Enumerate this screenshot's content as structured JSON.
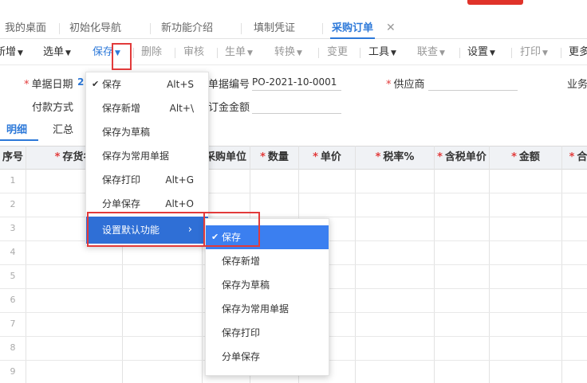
{
  "colors": {
    "accent": "#2d79d9",
    "highlight": "#3b7ff0",
    "annotation_red": "#e23a3a"
  },
  "tabs": [
    {
      "label": "我的桌面"
    },
    {
      "label": "初始化导航"
    },
    {
      "label": "新功能介绍"
    },
    {
      "label": "填制凭证"
    },
    {
      "label": "采购订单"
    }
  ],
  "tab_close": "✕",
  "toolbar": {
    "new": "新增",
    "select": "选单",
    "save": "保存",
    "delete": "删除",
    "audit": "审核",
    "generate": "生单",
    "convert": "转换",
    "change": "变更",
    "tools": "工具",
    "linked": "联查",
    "settings": "设置",
    "print": "打印",
    "more": "更多"
  },
  "form": {
    "date_label": "单据日期",
    "date_value": "2",
    "number_label": "单据编号",
    "number_value": "PO-2021-10-0001",
    "supplier_label": "供应商",
    "business_label": "业务",
    "payment_label": "付款方式",
    "deposit_label": "订金金额"
  },
  "subtabs": {
    "detail": "明细",
    "summary": "汇总"
  },
  "grid": {
    "columns": [
      "序号",
      "存货名",
      "",
      "采购单位",
      "数量",
      "单价",
      "税率%",
      "含税单价",
      "金额",
      "合"
    ],
    "required": [
      false,
      true,
      false,
      false,
      true,
      true,
      true,
      true,
      true,
      true
    ],
    "rows": [
      "1",
      "2",
      "3",
      "4",
      "5",
      "6",
      "7",
      "8",
      "9"
    ]
  },
  "save_menu": {
    "items": [
      {
        "label": "保存",
        "shortcut": "Alt+S",
        "checked": true
      },
      {
        "label": "保存新增",
        "shortcut": "Alt+\\",
        "checked": false
      },
      {
        "label": "保存为草稿",
        "shortcut": "",
        "checked": false
      },
      {
        "label": "保存为常用单据",
        "shortcut": "",
        "checked": false
      },
      {
        "label": "保存打印",
        "shortcut": "Alt+G",
        "checked": false
      },
      {
        "label": "分单保存",
        "shortcut": "Alt+O",
        "checked": false
      }
    ],
    "default_item": {
      "label": "设置默认功能",
      "arrow": "›"
    }
  },
  "default_submenu": {
    "items": [
      {
        "label": "保存",
        "checked": true
      },
      {
        "label": "保存新增",
        "checked": false
      },
      {
        "label": "保存为草稿",
        "checked": false
      },
      {
        "label": "保存为常用单据",
        "checked": false
      },
      {
        "label": "保存打印",
        "checked": false
      },
      {
        "label": "分单保存",
        "checked": false
      }
    ]
  }
}
